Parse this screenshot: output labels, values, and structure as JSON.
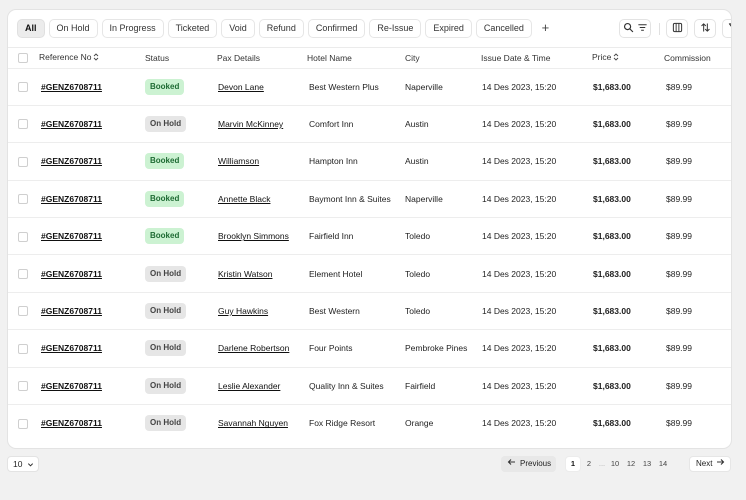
{
  "colors": {
    "booked_bg": "#ccf2d2",
    "booked_text": "#1e6b33",
    "onhold_bg": "#e6e6e6",
    "onhold_text": "#444444"
  },
  "tabs": [
    "All",
    "On Hold",
    "In Progress",
    "Ticketed",
    "Void",
    "Refund",
    "Confirmed",
    "Re-Issue",
    "Expired",
    "Cancelled"
  ],
  "add_tab_label": "+",
  "tools": {
    "search_filter": [
      "search-icon",
      "filter-lines-icon"
    ],
    "columns": "columns-icon",
    "sort": "sort-arrows-icon",
    "filter": "funnel-icon"
  },
  "table": {
    "headers": {
      "reference": "Reference No",
      "status": "Status",
      "pax": "Pax Details",
      "hotel": "Hotel Name",
      "city": "City",
      "issue": "Issue Date & Time",
      "price": "Price",
      "commission": "Commission"
    },
    "rows": [
      {
        "ref": "#GENZ6708711",
        "status": "Booked",
        "pax": "Devon Lane",
        "hotel": "Best Western Plus",
        "city": "Naperville",
        "issue": "14 Des 2023, 15:20",
        "price": "$1,683.00",
        "commission": "$89.99"
      },
      {
        "ref": "#GENZ6708711",
        "status": "On Hold",
        "pax": "Marvin McKinney",
        "hotel": "Comfort Inn",
        "city": "Austin",
        "issue": "14 Des 2023, 15:20",
        "price": "$1,683.00",
        "commission": "$89.99"
      },
      {
        "ref": "#GENZ6708711",
        "status": "Booked",
        "pax": "Williamson",
        "hotel": "Hampton Inn",
        "city": "Austin",
        "issue": "14 Des 2023, 15:20",
        "price": "$1,683.00",
        "commission": "$89.99"
      },
      {
        "ref": "#GENZ6708711",
        "status": "Booked",
        "pax": "Annette Black",
        "hotel": "Baymont Inn & Suites",
        "city": "Naperville",
        "issue": "14 Des 2023, 15:20",
        "price": "$1,683.00",
        "commission": "$89.99"
      },
      {
        "ref": "#GENZ6708711",
        "status": "Booked",
        "pax": "Brooklyn Simmons",
        "hotel": "Fairfield Inn",
        "city": "Toledo",
        "issue": "14 Des 2023, 15:20",
        "price": "$1,683.00",
        "commission": "$89.99"
      },
      {
        "ref": "#GENZ6708711",
        "status": "On Hold",
        "pax": "Kristin Watson",
        "hotel": "Element Hotel",
        "city": "Toledo",
        "issue": "14 Des 2023, 15:20",
        "price": "$1,683.00",
        "commission": "$89.99"
      },
      {
        "ref": "#GENZ6708711",
        "status": "On Hold",
        "pax": "Guy Hawkins",
        "hotel": "Best Western",
        "city": "Toledo",
        "issue": "14 Des 2023, 15:20",
        "price": "$1,683.00",
        "commission": "$89.99"
      },
      {
        "ref": "#GENZ6708711",
        "status": "On Hold",
        "pax": "Darlene Robertson",
        "hotel": "Four Points",
        "city": "Pembroke Pines",
        "issue": "14 Des 2023, 15:20",
        "price": "$1,683.00",
        "commission": "$89.99"
      },
      {
        "ref": "#GENZ6708711",
        "status": "On Hold",
        "pax": "Leslie Alexander",
        "hotel": "Quality Inn & Suites",
        "city": "Fairfield",
        "issue": "14 Des 2023, 15:20",
        "price": "$1,683.00",
        "commission": "$89.99"
      },
      {
        "ref": "#GENZ6708711",
        "status": "On Hold",
        "pax": "Savannah Nguyen",
        "hotel": "Fox Ridge Resort",
        "city": "Orange",
        "issue": "14 Des 2023, 15:20",
        "price": "$1,683.00",
        "commission": "$89.99"
      }
    ]
  },
  "footer": {
    "page_size": "10",
    "previous_label": "Previous",
    "next_label": "Next",
    "pages": [
      "1",
      "2",
      "...",
      "10",
      "12",
      "13",
      "14"
    ],
    "current_page": "1"
  }
}
